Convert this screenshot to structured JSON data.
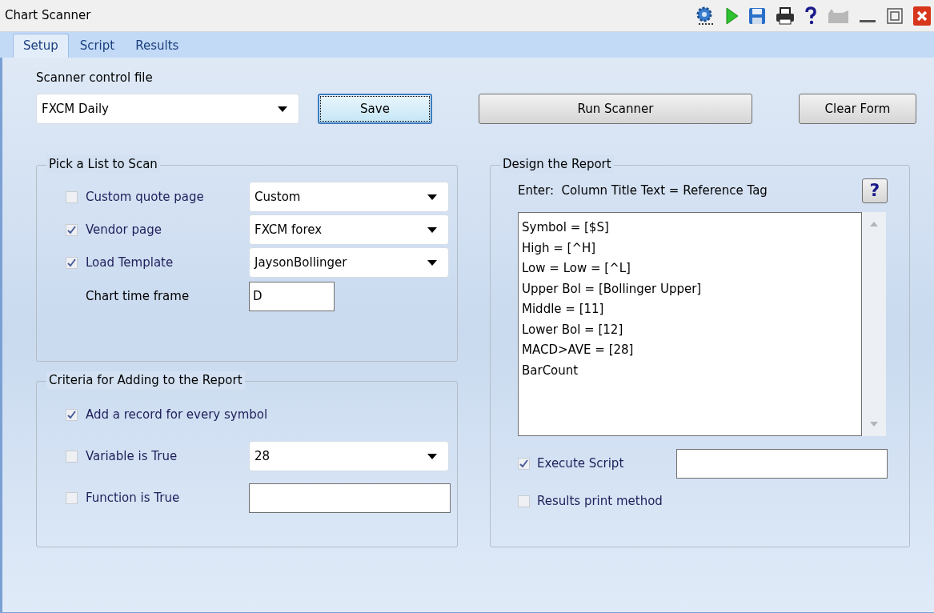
{
  "window": {
    "title": "Chart Scanner"
  },
  "tabs": [
    {
      "label": "Setup",
      "selected": true
    },
    {
      "label": "Script",
      "selected": false
    },
    {
      "label": "Results",
      "selected": false
    }
  ],
  "control_file": {
    "label": "Scanner control file",
    "value": "FXCM Daily"
  },
  "buttons": [
    {
      "label": "Save",
      "focused": true
    },
    {
      "label": "Run Scanner",
      "focused": false
    },
    {
      "label": "Clear Form",
      "focused": false
    }
  ],
  "pick_list": {
    "title": "Pick a List to Scan",
    "rows": [
      {
        "label": "Custom quote page",
        "checked": false,
        "value": "Custom"
      },
      {
        "label": "Vendor page",
        "checked": true,
        "value": "FXCM forex"
      },
      {
        "label": "Load Template",
        "checked": true,
        "value": "JaysonBollinger"
      }
    ],
    "timeframe": {
      "label": "Chart time frame",
      "value": "D"
    }
  },
  "criteria": {
    "title": "Criteria for Adding to the Report",
    "rows": [
      {
        "kind": "plain",
        "label": "Add a record for every symbol",
        "checked": true
      },
      {
        "kind": "combo",
        "label": "Variable is True",
        "checked": false,
        "value": "28"
      },
      {
        "kind": "field",
        "label": "Function is True",
        "checked": false
      }
    ]
  },
  "report": {
    "title": "Design the Report",
    "instruction": "Enter:  Column Title Text = Reference Tag",
    "help": "?",
    "lines": [
      "Symbol = [$S]",
      "High = [^H]",
      "Low = Low = [^L]",
      "Upper Bol = [Bollinger Upper]",
      "Middle = [11]",
      "Lower Bol = [12]",
      "MACD>AVE = [28]",
      "BarCount"
    ],
    "execute_script": {
      "label": "Execute Script",
      "checked": true
    },
    "results_print": {
      "label": "Results print method",
      "checked": false
    }
  }
}
